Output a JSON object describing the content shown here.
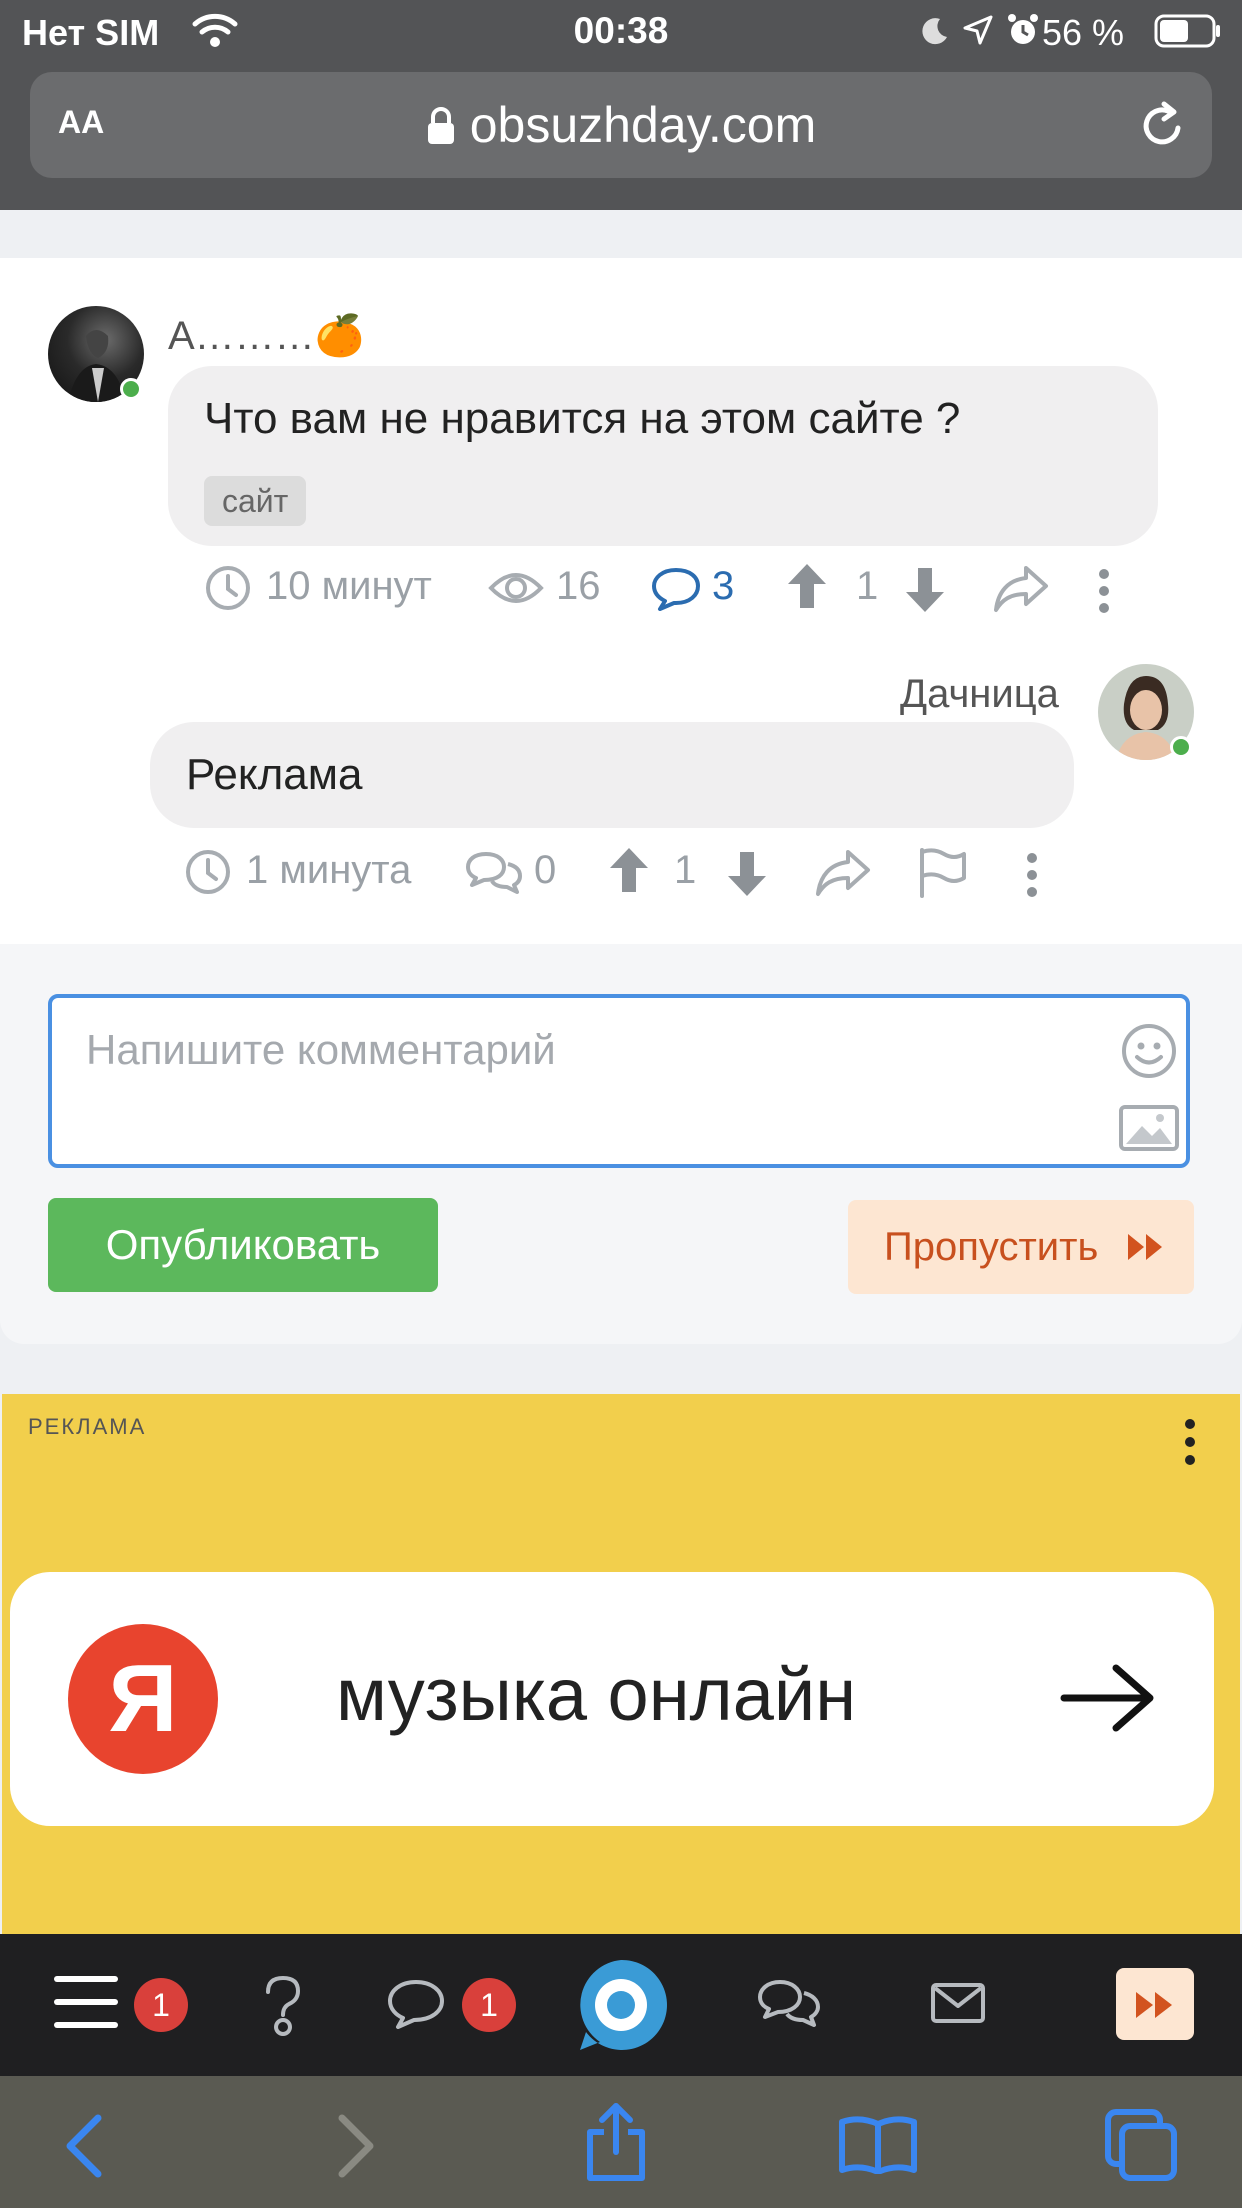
{
  "status": {
    "carrier": "Нет SIM",
    "time": "00:38",
    "battery": "56 %"
  },
  "browser": {
    "text_size": "AA",
    "url": "obsuzhday.com"
  },
  "post": {
    "author": "А………🍊",
    "question": "Что вам не нравится на этом сайте ?",
    "tag": "сайт",
    "time": "10 минут",
    "views": "16",
    "comments": "3",
    "votes": "1"
  },
  "reply": {
    "author": "Дачница",
    "text": "Реклама",
    "time": "1 минута",
    "comments": "0",
    "votes": "1"
  },
  "composer": {
    "placeholder": "Напишите комментарий",
    "publish_label": "Опубликовать",
    "skip_label": "Пропустить"
  },
  "ad": {
    "label": "РЕКЛАМА",
    "logo_letter": "Я",
    "text": "музыка онлайн"
  },
  "appnav": {
    "menu_badge": "1",
    "chat_badge": "1"
  },
  "colors": {
    "accent": "#4a90e2",
    "publish": "#5cb85c",
    "skip_bg": "#fde6d2",
    "skip_text": "#c8501e",
    "ad_bg": "#f2cf4c",
    "badge": "#d9403b",
    "comment_link": "#2b6cb0"
  }
}
